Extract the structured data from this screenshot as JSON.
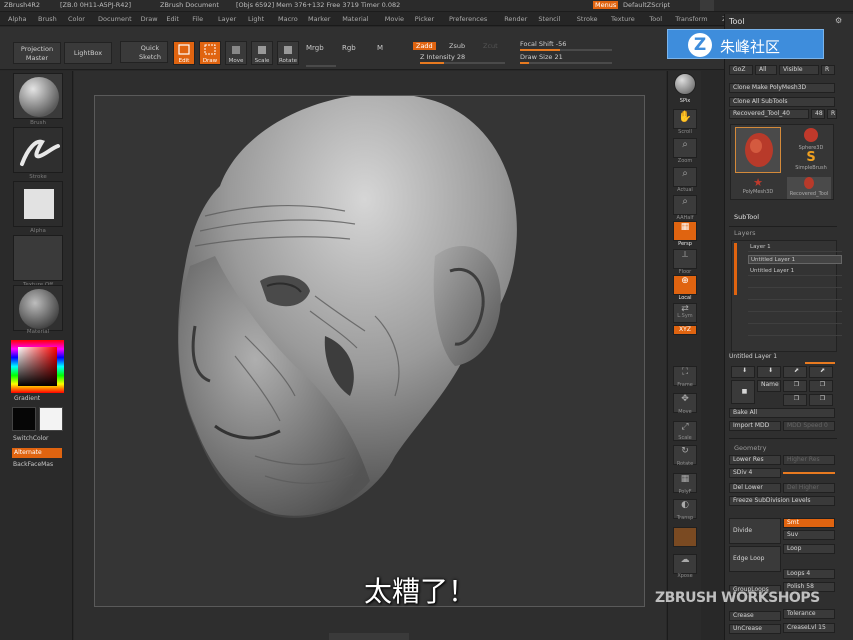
{
  "titlebar": {
    "app": "ZBrush4R2",
    "build": "[ZB.0 0H11-A5PJ-R42]",
    "doc": "ZBrush Document",
    "stats": "[Objs 6592]  Mem 376+132  Free 3719  Timer 0.082",
    "menus_btn": "Menus",
    "zscript": "DefaultZScript"
  },
  "menubar": {
    "items": [
      "Alpha",
      "Brush",
      "Color",
      "Document",
      "Draw",
      "Edit",
      "File",
      "Layer",
      "Light",
      "Macro",
      "Marker",
      "Material",
      "Movie",
      "Picker",
      "Preferences",
      "Render",
      "Stencil",
      "Stroke",
      "Texture",
      "Tool",
      "Transform",
      "Zplugin",
      "Zscript"
    ]
  },
  "toolbar": {
    "projection_master": "Projection Master",
    "lightbox": "LightBox",
    "quick_sketch": "Quick Sketch",
    "edit": "Edit",
    "draw": "Draw",
    "move": "Move",
    "scale": "Scale",
    "rotate": "Rotate",
    "mrgb": "Mrgb",
    "rgb": "Rgb",
    "m": "M",
    "zadd": "Zadd",
    "zsub": "Zsub",
    "zcut": "Zcut",
    "focal_shift": "Focal Shift -56",
    "focal_shift_value": 0.44,
    "z_intensity": "Z Intensity 28",
    "z_intensity_value": 0.28,
    "draw_size": "Draw Size 21",
    "draw_size_value": 0.1
  },
  "leftshelf": {
    "labels": [
      "Brush",
      "Stroke",
      "Alpha",
      "Texture Off",
      "Material"
    ],
    "gradient": "Gradient",
    "switch_color": "SwitchColor",
    "alternate": "Alternate",
    "backface": "BackFaceMas"
  },
  "rightshelf": {
    "spix": "SPix",
    "scroll": "Scroll",
    "zoom": "Zoom",
    "actual": "Actual",
    "aahalf": "AAHalf",
    "persp": "Persp",
    "floor": "Floor",
    "local": "Local",
    "lsym": "L.Sym",
    "xyz": "XYZ",
    "frame": "Frame",
    "move": "Move",
    "scale": "Scale",
    "rotate": "Rotate",
    "polyf": "PolyF",
    "transp": "Transp",
    "ghost": "Ghost",
    "solo": "Solo",
    "xpose": "Xpose"
  },
  "toolpanel": {
    "title": "Tool",
    "goz": "GoZ",
    "all": "All",
    "visible": "Visible",
    "r": "R",
    "clone": "Clone  Make PolyMesh3D",
    "clone_all": "Clone All SubTools",
    "current_tool": "Recovered_Tool_40",
    "current_tool_num": "48",
    "tools": [
      "Recovered_Tool_40",
      "Sphere3D",
      "SimpleBrush",
      "PolyMesh3D",
      "Recovered_Tool"
    ],
    "subtool": "SubTool",
    "layers": "Layers",
    "layer_rows": [
      "Layer 1",
      "Untitled Layer 1",
      "Untitled Layer 1"
    ],
    "untitled_layer": "Untitled Layer 1",
    "name": "Name",
    "bake_all": "Bake All",
    "import_mdd": "Import MDD",
    "mdd_speed": "MDD Speed 0",
    "geometry": "Geometry",
    "lower_res": "Lower Res",
    "higher_res": "Higher Res",
    "sdiv": "SDiv 4",
    "del_lower": "Del Lower",
    "del_higher": "Del Higher",
    "freeze_subdiv": "Freeze SubDivision Levels",
    "divide": "Divide",
    "smt": "Smt",
    "suv": "Suv",
    "edge_loop": "Edge Loop",
    "loops": "Loops 4",
    "group_loops": "GroupLoops",
    "polish": "Polish 58",
    "crease": "Crease",
    "tolerance": "Tolerance",
    "uncrease": "UnCrease",
    "crease_lvl": "CreaseLvl 15"
  },
  "logo": {
    "z": "Z",
    "text": "朱峰社区"
  },
  "subtitle": "太糟了！",
  "watermark": "ZBRUSH WORKSHOPS",
  "colors": {
    "accent": "#e06410",
    "logo_blue": "#3e8ddc"
  }
}
